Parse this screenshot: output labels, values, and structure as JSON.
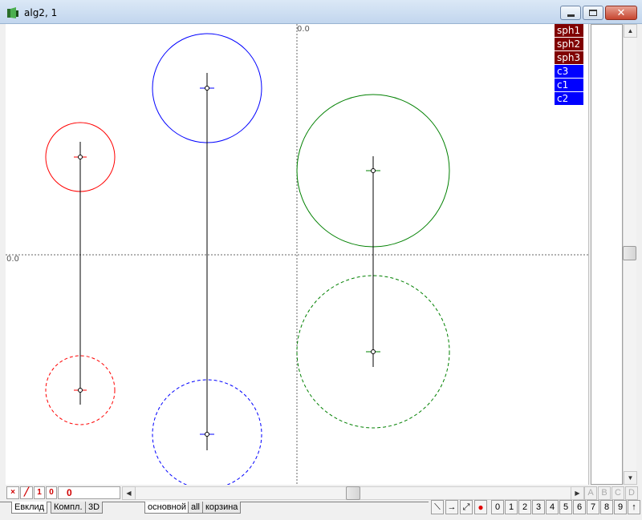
{
  "window": {
    "title": "alg2, 1"
  },
  "canvas": {
    "origin_label_top": "0.0",
    "origin_label_left": "0.0"
  },
  "layers": [
    {
      "label": "sph1",
      "color": "#800000"
    },
    {
      "label": "sph2",
      "color": "#800000"
    },
    {
      "label": "sph3",
      "color": "#800000"
    },
    {
      "label": "c3",
      "color": "#0000ff"
    },
    {
      "label": "c1",
      "color": "#0000ff"
    },
    {
      "label": "c2",
      "color": "#0000ff"
    }
  ],
  "toolbar_left": {
    "delete_icon": "×",
    "line_icon": "╱",
    "one_label": "1",
    "zero_label": "0",
    "counter": "0"
  },
  "letter_buttons": [
    "A",
    "B",
    "C",
    "D"
  ],
  "tabs_left": [
    "Евклид",
    "Компл.",
    "3D"
  ],
  "tabs_right": [
    "основной",
    "all",
    "корзина"
  ],
  "digit_buttons": [
    "0",
    "1",
    "2",
    "3",
    "4",
    "5",
    "6",
    "7",
    "8",
    "9",
    "↑"
  ],
  "colors": {
    "red": "#ff0000",
    "blue": "#0000ff",
    "green": "#008000"
  }
}
